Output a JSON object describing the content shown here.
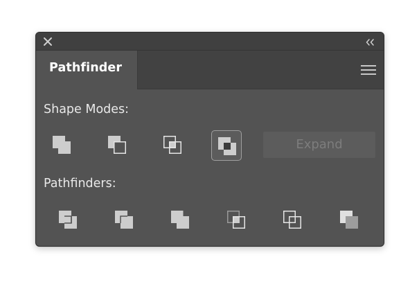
{
  "panel": {
    "tab_title": "Pathfinder",
    "icons": {
      "close": "close-icon",
      "collapse": "double-chevron-left-icon",
      "menu": "hamburger-menu-icon"
    }
  },
  "shape_modes": {
    "label": "Shape Modes:",
    "buttons": [
      {
        "name": "unite",
        "icon": "unite-icon",
        "selected": false
      },
      {
        "name": "minus-front",
        "icon": "minus-front-icon",
        "selected": false
      },
      {
        "name": "intersect",
        "icon": "intersect-icon",
        "selected": false
      },
      {
        "name": "exclude",
        "icon": "exclude-icon",
        "selected": true
      }
    ],
    "expand_label": "Expand",
    "expand_enabled": false
  },
  "pathfinders": {
    "label": "Pathfinders:",
    "buttons": [
      {
        "name": "divide",
        "icon": "divide-icon"
      },
      {
        "name": "trim",
        "icon": "trim-icon"
      },
      {
        "name": "merge",
        "icon": "merge-icon"
      },
      {
        "name": "crop",
        "icon": "crop-icon"
      },
      {
        "name": "outline",
        "icon": "outline-icon"
      },
      {
        "name": "minus-back",
        "icon": "minus-back-icon"
      }
    ]
  },
  "colors": {
    "panel_bg": "#535353",
    "header_bg": "#404040",
    "icon_fill": "#cdcdcd",
    "icon_stroke": "#e6e6e6",
    "label_text": "#e9e9e9",
    "disabled_text": "#7d7d7d"
  }
}
